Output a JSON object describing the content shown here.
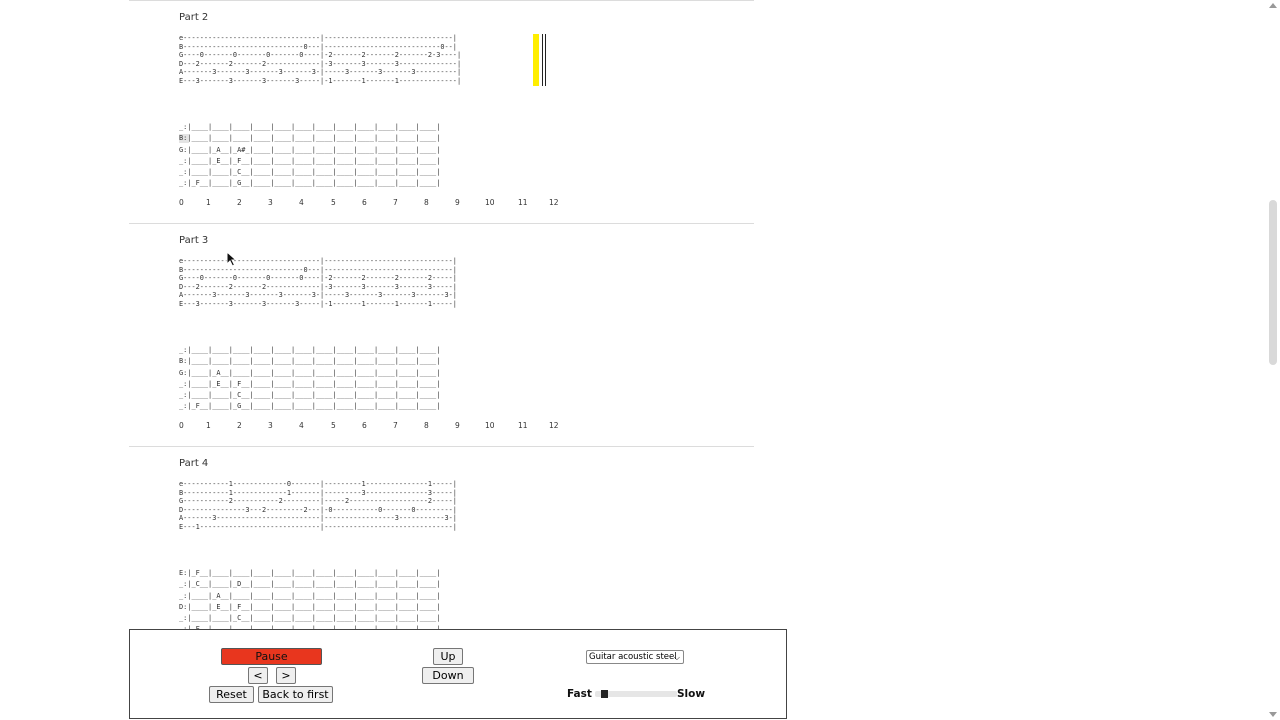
{
  "parts": [
    {
      "title": "Part 2",
      "tab": "e---------------------------------|-------------------------------|\nB-----------------------------0---|----------------------------0--|\nG----0-------0-------0-------0----|-2-------2-------2-------2-3----|\nD---2-------2-------2-------------|-3-------3-------3--------------|\nA-------3-------3-------3-------3-|-----3-------3-------3----------|\nE---3-------3-------3-------3-----|-1-------1-------1--------------|",
      "fretboard": "_:|____|____|____|____|____|____|____|____|____|____|____|____|\nB:|____|____|____|____|____|____|____|____|____|____|____|____|\nG:|____|_A__|_A#_|____|____|____|____|____|____|____|____|____|\n_:|____|_E__|_F__|____|____|____|____|____|____|____|____|____|\n_:|____|____|_C__|____|____|____|____|____|____|____|____|____|\n_:|_F__|____|_G__|____|____|____|____|____|____|____|____|____|"
    },
    {
      "title": "Part 3",
      "tab": "e---------------------------------|-------------------------------|\nB-----------------------------0---|-------------------------------|\nG----0-------0-------0-------0----|-2-------2-------2-------2-----|\nD---2-------2-------2-------------|-3-------3-------3-------3-----|\nA-------3-------3-------3-------3-|-----3-------3-------3-------3-|\nE---3-------3-------3-------3-----|-1-------1-------1-------1-----|",
      "fretboard": "_:|____|____|____|____|____|____|____|____|____|____|____|____|\nB:|____|____|____|____|____|____|____|____|____|____|____|____|\nG:|____|_A__|____|____|____|____|____|____|____|____|____|____|\n_:|____|_E__|_F__|____|____|____|____|____|____|____|____|____|\n_:|____|____|_C__|____|____|____|____|____|____|____|____|____|\n_:|_F__|____|_G__|____|____|____|____|____|____|____|____|____|"
    },
    {
      "title": "Part 4",
      "tab": "e-----------1-------------0-------|---------1---------------1-----|\nB-----------1-------------1-------|---------3---------------3-----|\nG-----------2-----------2---------|-----2-------------------2-----|\nD---------------3---2---------2---|-0-----------0-------0---------|\nA-------3-------------------------|-----------------3-----------3-|\nE---1-----------------------------|-------------------------------|",
      "fretboard": "E:|_F__|____|____|____|____|____|____|____|____|____|____|____|\n_:|_C__|____|_D__|____|____|____|____|____|____|____|____|____|\n_:|____|_A__|____|____|____|____|____|____|____|____|____|____|\nD:|____|_E__|_F__|____|____|____|____|____|____|____|____|____|\n_:|____|____|_C__|____|____|____|____|____|____|____|____|____|\n_:|_F__|____|____|____|____|____|____|____|____|____|____|____|"
    }
  ],
  "fret_numbers": [
    "0",
    "1",
    "2",
    "3",
    "4",
    "5",
    "6",
    "7",
    "8",
    "9",
    "10",
    "11",
    "12"
  ],
  "controls": {
    "pause_label": "Pause",
    "prev_label": "<",
    "next_label": ">",
    "reset_label": "Reset",
    "back_to_first_label": "Back to first",
    "up_label": "Up",
    "down_label": "Down",
    "instrument_selected": "Guitar acoustic steel",
    "speed_fast_label": "Fast",
    "speed_slow_label": "Slow",
    "speed_fraction": 0.08
  },
  "colors": {
    "pause_button": "#e8361e",
    "playback_cursor": "#ffee00"
  },
  "icons": {
    "dropdown": "chevron-down-icon",
    "pointer": "mouse-pointer-icon"
  }
}
